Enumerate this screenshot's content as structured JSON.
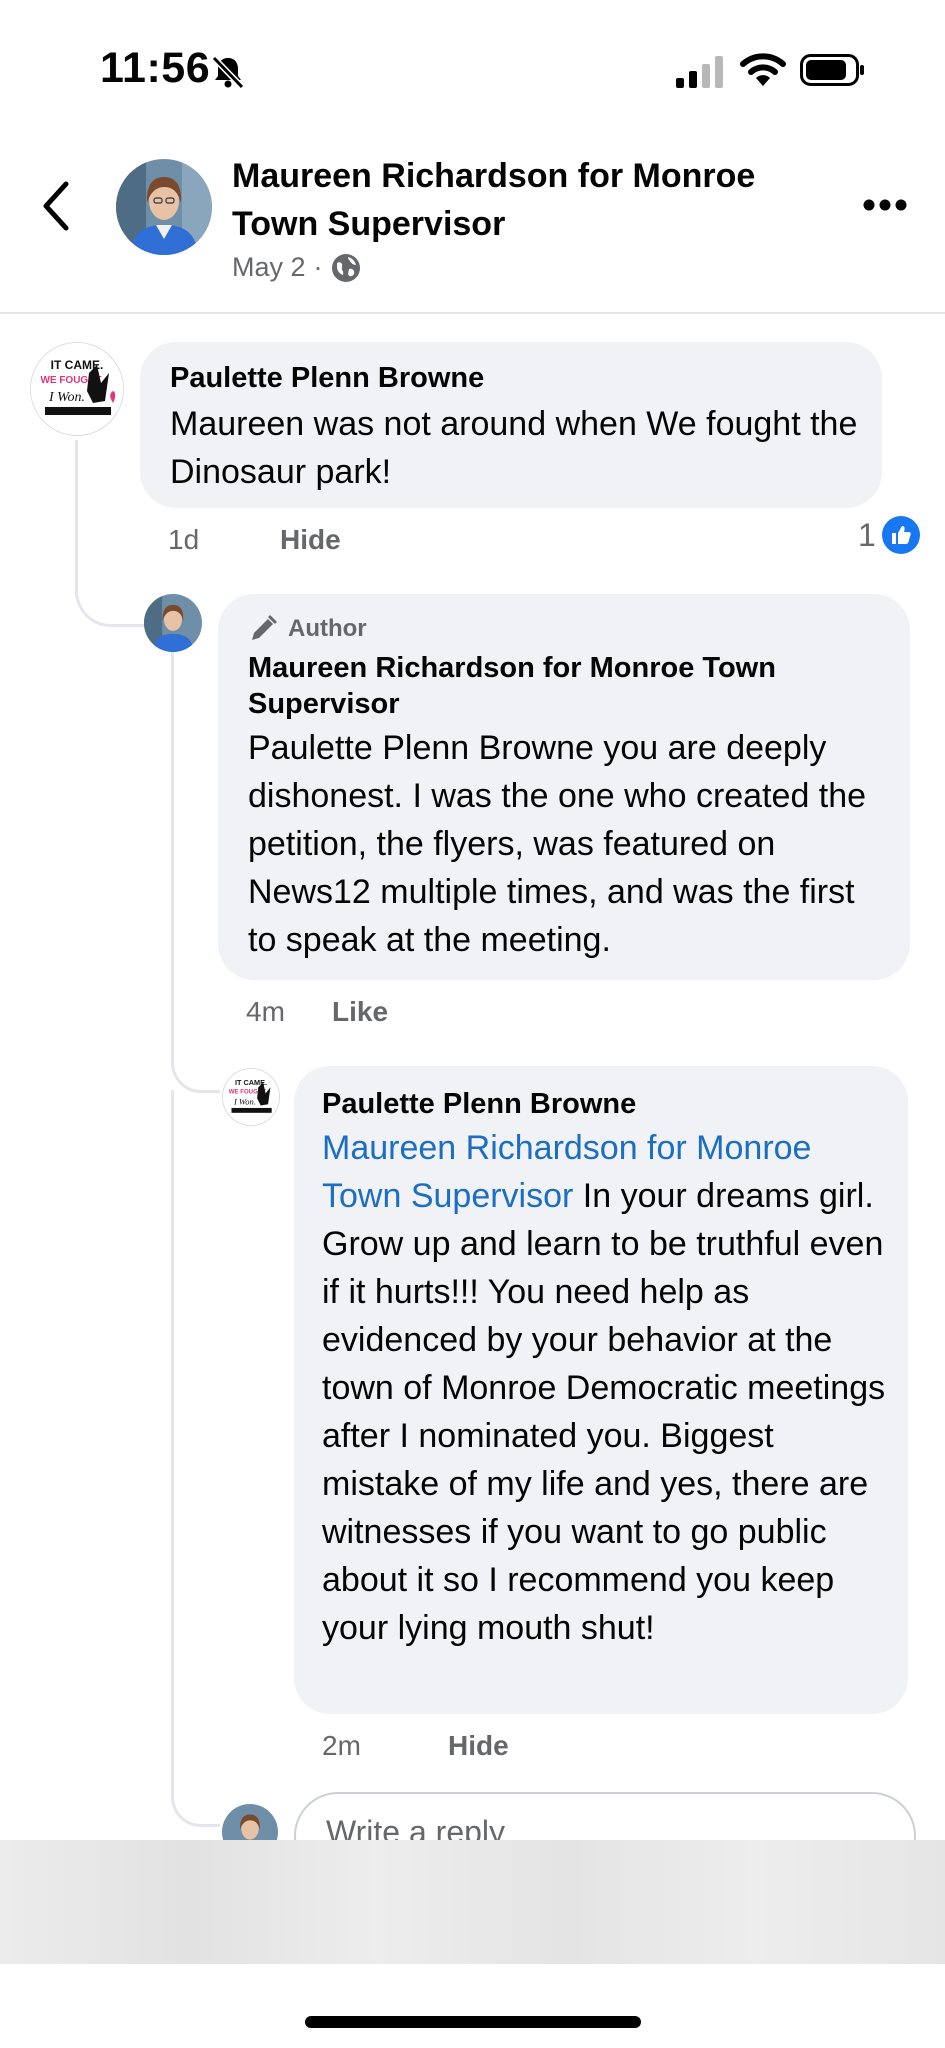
{
  "status_bar": {
    "time": "11:56"
  },
  "header": {
    "page_name": "Maureen Richardson for Monroe Town Supervisor",
    "date": "May 2",
    "separator": "·",
    "privacy_icon": "globe-icon"
  },
  "comments": [
    {
      "author": "Paulette Plenn Browne",
      "text": "Maureen was not around when We fought the Dinosaur park!",
      "time": "1d",
      "action": "Hide",
      "reaction_count": "1",
      "reaction_icon": "thumbs-up-icon"
    },
    {
      "badge": "Author",
      "author": "Maureen Richardson for Monroe Town Supervisor",
      "text": "Paulette Plenn Browne you are deeply dishonest. I was the one who created the petition, the flyers, was featured on News12 multiple times, and was the first to speak at the meeting.",
      "time": "4m",
      "action": "Like"
    },
    {
      "author": "Paulette Plenn Browne",
      "mention": "Maureen Richardson for Monroe Town Supervisor",
      "text": " In your dreams girl.  Grow up and learn to be truthful even if it hurts!!!  You need help as evidenced by your behavior at the town of Monroe Democratic meetings after I nominated you.  Biggest mistake of my life and yes, there are witnesses if you want to go public about it so I recommend you keep your lying mouth shut!",
      "time": "2m",
      "action": "Hide"
    }
  ],
  "reply_box": {
    "placeholder": "Write a reply"
  },
  "colors": {
    "accent": "#1877f2",
    "mention": "#1b6ec2",
    "bubble": "#f0f2f5",
    "muted": "#65676b"
  }
}
